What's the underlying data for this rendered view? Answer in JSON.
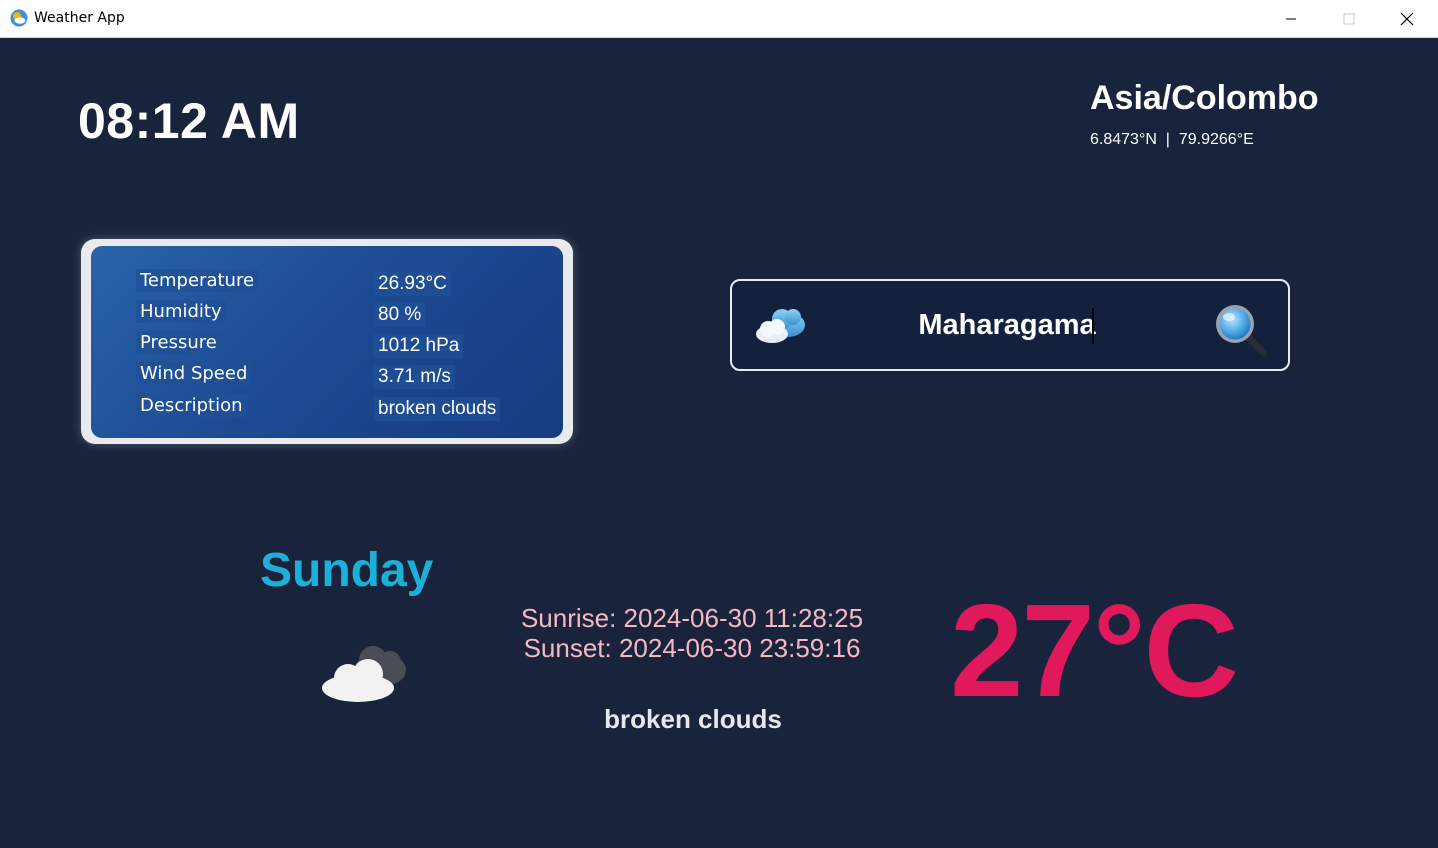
{
  "window": {
    "title": "Weather App",
    "icon": "weather-app-icon",
    "controls": [
      "minimize",
      "maximize",
      "close"
    ]
  },
  "clock": {
    "time": "08:12 AM"
  },
  "location": {
    "timezone": "Asia/Colombo",
    "coordinates": "6.8473°N  |  79.9266°E"
  },
  "details": {
    "rows": [
      {
        "label": "Temperature",
        "value": "26.93°C"
      },
      {
        "label": "Humidity",
        "value": "80 %"
      },
      {
        "label": "Pressure",
        "value": "1012 hPa"
      },
      {
        "label": "Wind Speed",
        "value": "3.71 m/s"
      },
      {
        "label": "Description",
        "value": "broken clouds"
      }
    ]
  },
  "search": {
    "value": "Maharagama",
    "icon": "magnifier-icon",
    "left_icon": "cloud-icon"
  },
  "today": {
    "day": "Sunday",
    "icon": "broken-clouds-icon",
    "sunrise": "Sunrise: 2024-06-30 11:28:25",
    "sunset": "Sunset: 2024-06-30 23:59:16",
    "description": "broken clouds",
    "temperature": "27°C"
  },
  "colors": {
    "background": "#19233b",
    "day_accent": "#1cb0d8",
    "temperature_accent": "#e0185c",
    "sun_text": "#f5b8c4"
  }
}
